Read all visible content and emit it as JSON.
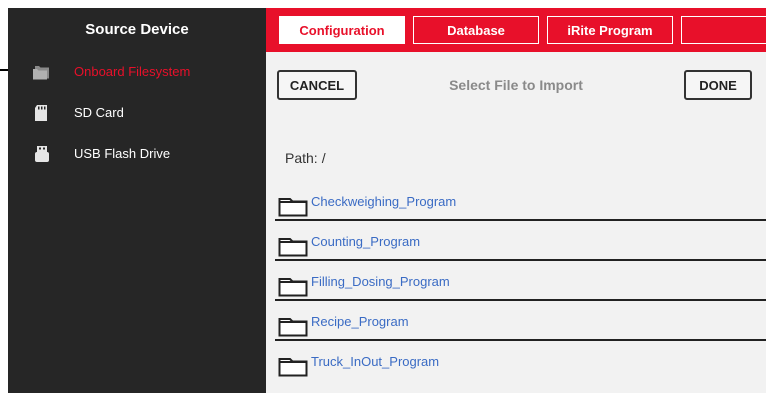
{
  "sidebar": {
    "title": "Source Device",
    "items": [
      {
        "label": "Onboard Filesystem",
        "icon": "folder-stack-icon",
        "active": true
      },
      {
        "label": "SD Card",
        "icon": "sd-card-icon",
        "active": false
      },
      {
        "label": "USB Flash Drive",
        "icon": "usb-drive-icon",
        "active": false
      }
    ]
  },
  "tabs": [
    {
      "label": "Configuration",
      "active": true
    },
    {
      "label": "Database",
      "active": false
    },
    {
      "label": "iRite Program",
      "active": false
    }
  ],
  "dialog": {
    "cancel_label": "CANCEL",
    "title": "Select File to Import",
    "done_label": "DONE"
  },
  "path": {
    "label": "Path:",
    "value": "/"
  },
  "files": [
    {
      "name": "Checkweighing_Program",
      "icon": "folder-icon"
    },
    {
      "name": "Counting_Program",
      "icon": "folder-icon"
    },
    {
      "name": "Filling_Dosing_Program",
      "icon": "folder-icon"
    },
    {
      "name": "Recipe_Program",
      "icon": "folder-icon"
    },
    {
      "name": "Truck_InOut_Program",
      "icon": "folder-icon"
    }
  ],
  "colors": {
    "accent": "#e8102a",
    "sidebar_bg": "#262626",
    "content_bg": "#f2f2f2",
    "link": "#3a6bc4"
  }
}
